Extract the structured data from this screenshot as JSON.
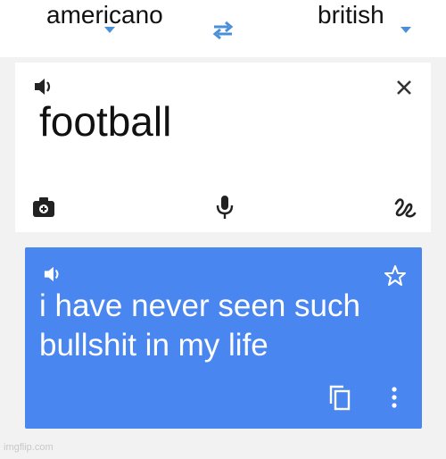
{
  "header": {
    "source_language": "americano",
    "target_language": "british",
    "swap_icon": "swap-arrows-icon",
    "accent_color": "#4a90d9"
  },
  "input": {
    "text": "football",
    "icons": [
      "speaker-icon",
      "close-icon",
      "camera-icon",
      "microphone-icon",
      "handwriting-icon"
    ]
  },
  "output": {
    "text": "i have never seen such bullshit in my life",
    "background_color": "#4a86f0",
    "icons": [
      "speaker-icon",
      "star-icon",
      "copy-icon",
      "more-vert-icon"
    ]
  },
  "watermark": "imgflip.com"
}
